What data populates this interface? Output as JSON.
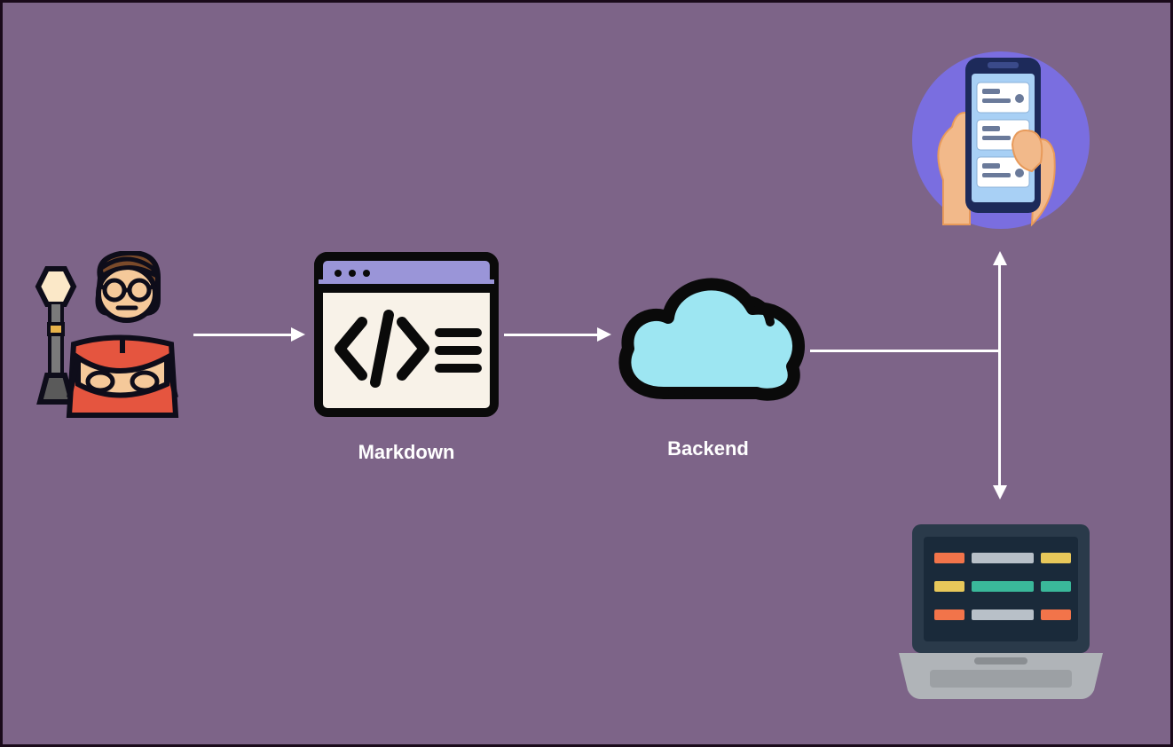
{
  "nodes": {
    "author": {
      "label": ""
    },
    "markdown": {
      "label": "Markdown"
    },
    "backend": {
      "label": "Backend"
    },
    "mobile": {
      "label": ""
    },
    "laptop": {
      "label": ""
    }
  },
  "edges": [
    {
      "from": "author",
      "to": "markdown",
      "direction": "right"
    },
    {
      "from": "markdown",
      "to": "backend",
      "direction": "right"
    },
    {
      "from": "backend",
      "to": "mobile",
      "direction": "up-branch"
    },
    {
      "from": "backend",
      "to": "laptop",
      "direction": "down-branch"
    }
  ],
  "colors": {
    "background": "#7d6488",
    "border": "#1a0a1a",
    "arrow": "#ffffff",
    "label": "#ffffff"
  }
}
